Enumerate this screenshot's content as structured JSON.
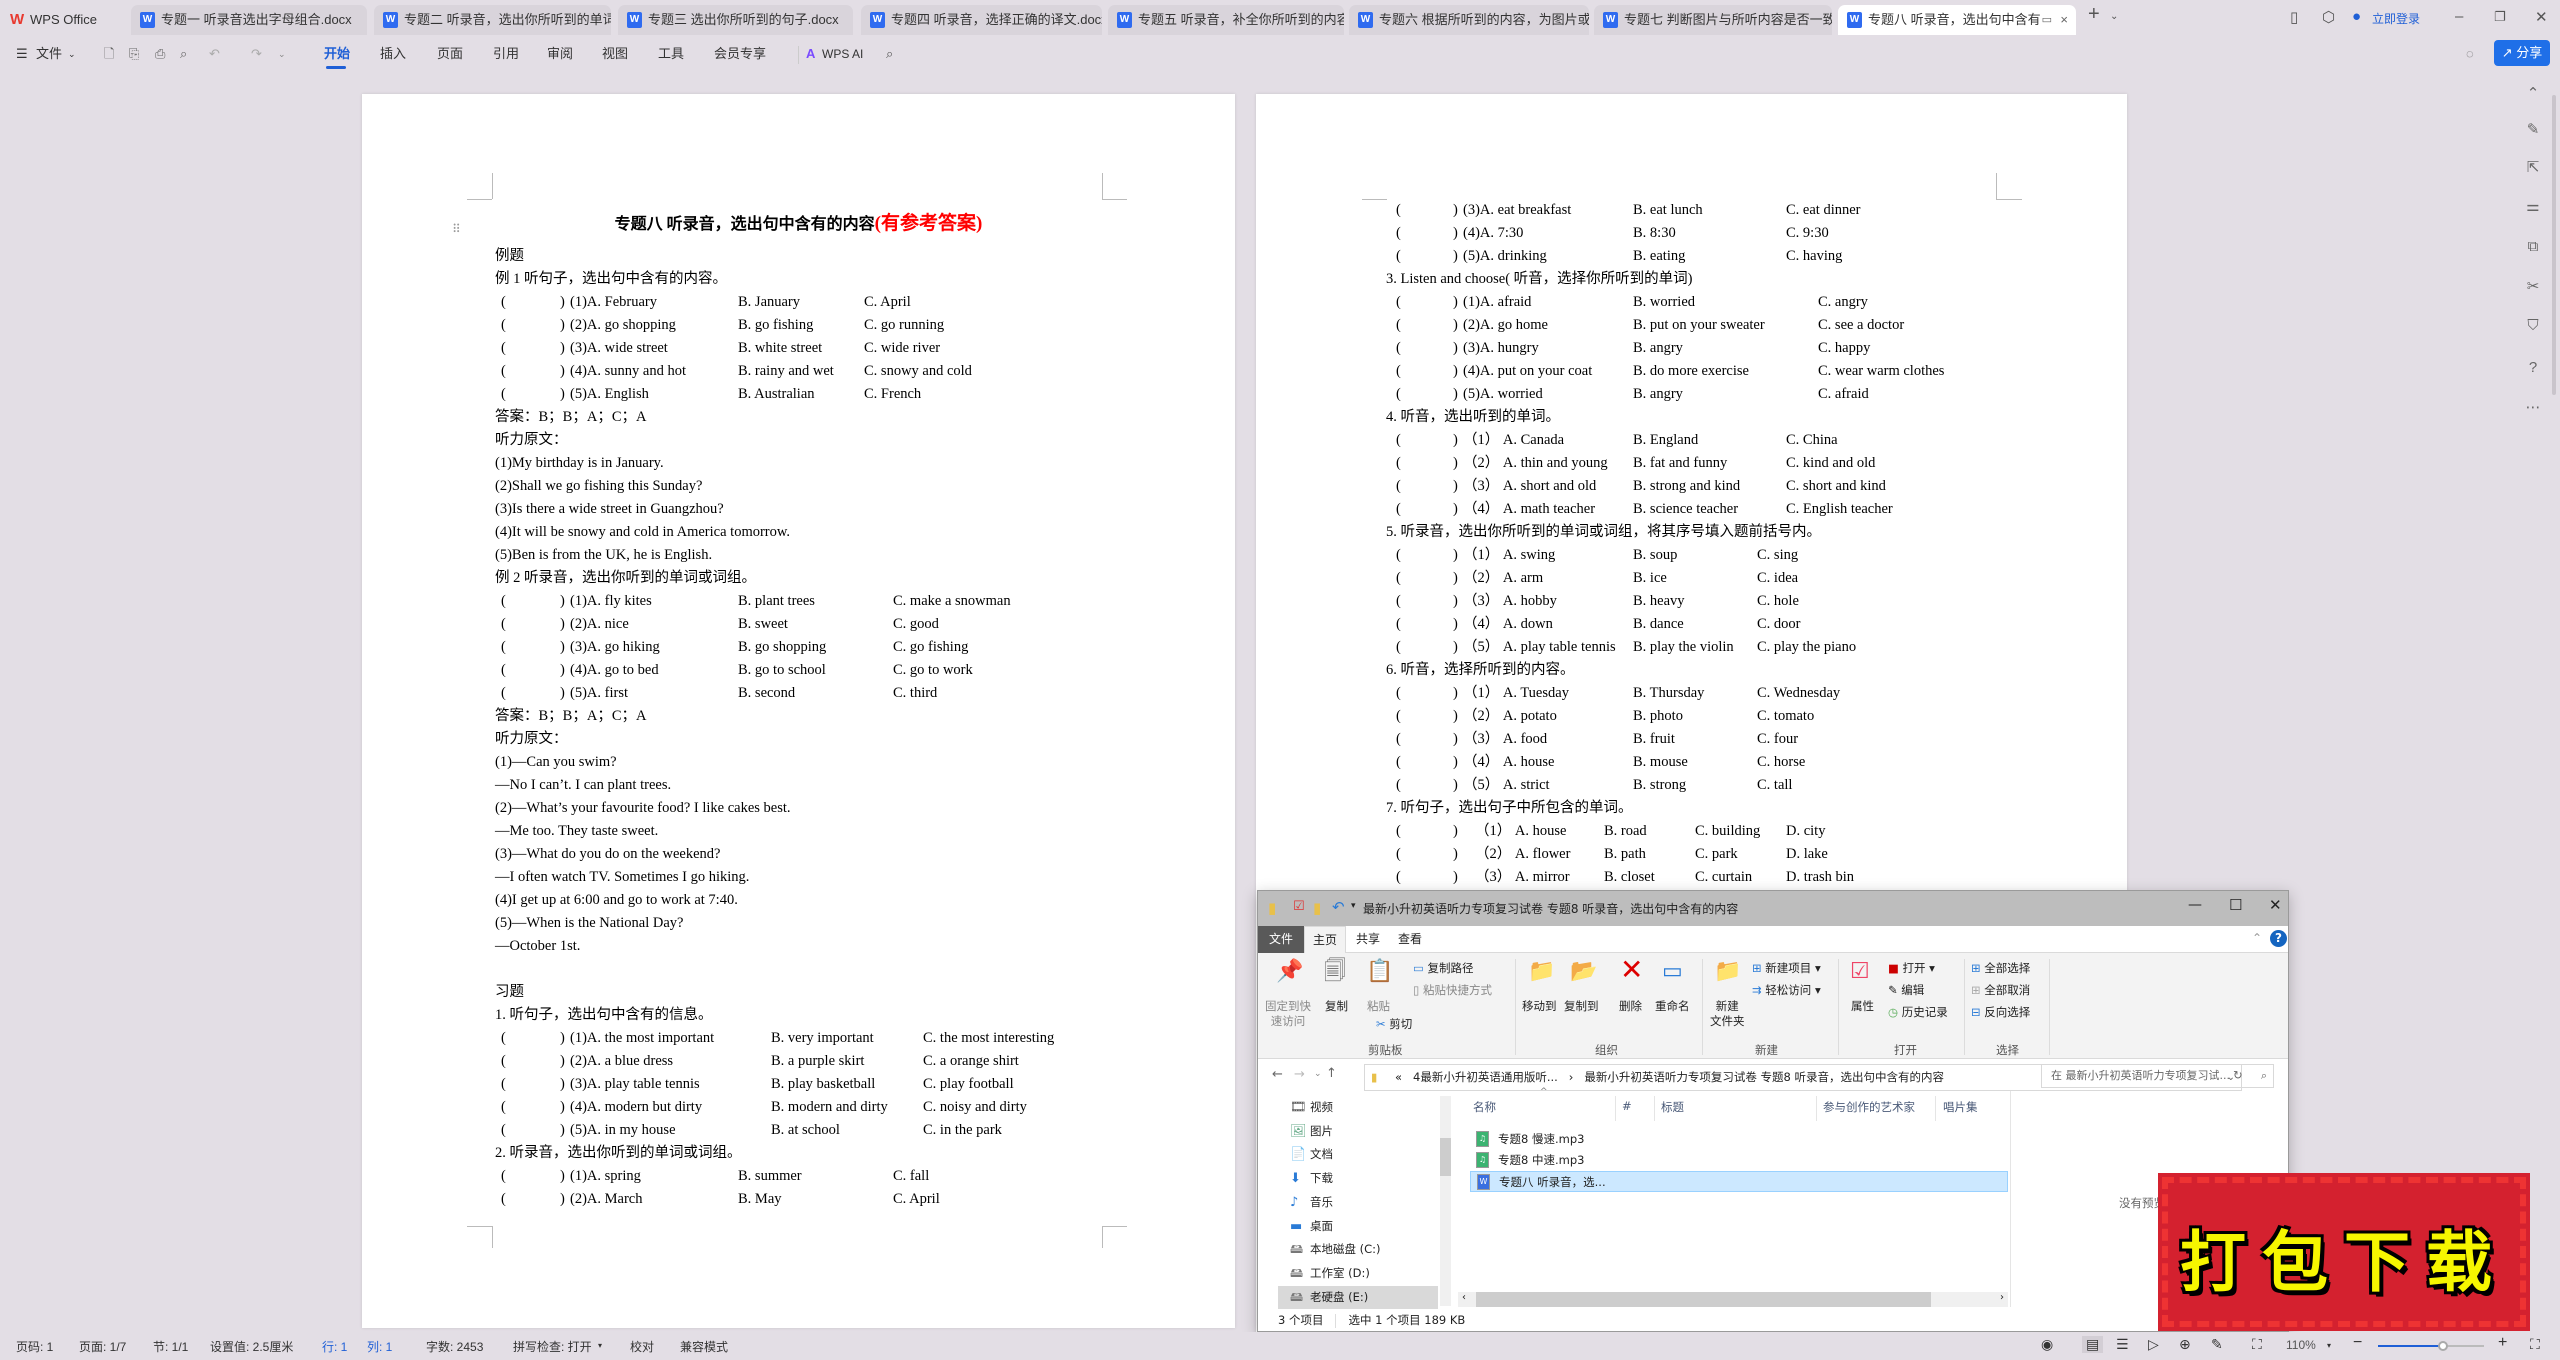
{
  "app": {
    "brand": "WPS Office",
    "tabs": [
      "专题一 听录音选出字母组合.docx",
      "专题二 听录音，选出你所听到的单词",
      "专题三 选出你所听到的句子.docx",
      "专题四 听录音，选择正确的译文.docx",
      "专题五 听录音，补全你所听到的内容",
      "专题六 根据所听到的内容，为图片或",
      "专题七 判断图片与所听内容是否一致",
      "专题八 听录音，选出句中含有"
    ],
    "active_tab": 7,
    "login": "立即登录"
  },
  "toolbar": {
    "file": "文件",
    "menus": [
      "开始",
      "插入",
      "页面",
      "引用",
      "审阅",
      "视图",
      "工具",
      "会员专享"
    ],
    "ai": "WPS AI",
    "share": "分享",
    "accent": "#1f5fd6"
  },
  "doc": {
    "title_main": "专题八  听录音，选出句中含有的内容",
    "title_note": "(有参考答案)",
    "blank": [
      "(",
      ")"
    ],
    "left_blocks": [
      {
        "heading": "例题"
      },
      {
        "heading": "例 1  听句子，选出句中含有的内容。",
        "rows": [
          [
            "(1)A. February",
            "B. January",
            "C. April"
          ],
          [
            "(2)A. go shopping",
            "B. go  fishing",
            "C. go running"
          ],
          [
            "(3)A. wide street",
            "B. white street",
            "C. wide river"
          ],
          [
            "(4)A. sunny and hot",
            "B. rainy and wet",
            "C. snowy and cold"
          ],
          [
            "(5)A. English",
            "B. Australian",
            "C. French"
          ]
        ],
        "lines": [
          "答案：B；B；A；C；A",
          "听力原文：",
          "(1)My birthday is in January.",
          "(2)Shall we go fishing this Sunday?",
          "(3)Is there a wide street in Guangzhou?",
          "(4)It will be snowy and cold in America tomorrow.",
          "(5)Ben is from the UK, he is English."
        ]
      },
      {
        "heading": "例 2 听录音，选出你听到的单词或词组。",
        "rows": [
          [
            "(1)A. fly kites",
            "B. plant trees",
            "C. make a snowman"
          ],
          [
            "(2)A. nice",
            "B. sweet",
            "C. good"
          ],
          [
            "(3)A. go hiking",
            "B. go shopping",
            "C. go fishing"
          ],
          [
            "(4)A. go to bed",
            "B. go to school",
            "C. go to work"
          ],
          [
            "(5)A. first",
            "B. second",
            "C. third"
          ]
        ],
        "lines": [
          "答案：B；B；A；C；A",
          "听力原文：",
          "(1)—Can you swim?",
          "—No I can’t. I can plant trees.",
          "(2)—What’s your favourite food? I like cakes best.",
          "—Me too. They taste sweet.",
          "(3)—What do you do on the weekend?",
          "—I often watch TV. Sometimes I go hiking.",
          "(4)I get up at 6:00 and go to work at 7:40.",
          "(5)—When is the National Day?",
          "—October 1st.",
          ""
        ]
      },
      {
        "heading": "习题"
      },
      {
        "heading": "1. 听句子，选出句中含有的信息。",
        "rows": [
          [
            "(1)A. the most important",
            "B. very important",
            "C. the most interesting"
          ],
          [
            "(2)A. a blue dress",
            "B. a purple skirt",
            "C. a orange shirt"
          ],
          [
            "(3)A. play table tennis",
            "B. play basketball",
            "C. play football"
          ],
          [
            "(4)A. modern but dirty",
            "B. modern and dirty",
            "C. noisy and dirty"
          ],
          [
            "(5)A. in my house",
            "B. at school",
            "C. in the park"
          ]
        ]
      },
      {
        "heading": "2. 听录音，选出你听到的单词或词组。",
        "rows": [
          [
            "(1)A. spring",
            "B. summer",
            "C. fall"
          ],
          [
            "(2)A. March",
            "B. May",
            "C. April"
          ]
        ]
      }
    ],
    "right_blocks": [
      {
        "rows": [
          [
            "(3)A. eat breakfast",
            "B. eat lunch",
            "C. eat dinner"
          ],
          [
            "(4)A. 7:30",
            "B. 8:30",
            "C. 9:30"
          ],
          [
            "(5)A. drinking",
            "B. eating",
            "C. having"
          ]
        ]
      },
      {
        "heading": "3. Listen and choose( 听音，选择你所听到的单词)",
        "rows": [
          [
            "(1)A. afraid",
            "B. worried",
            "C. angry"
          ],
          [
            "(2)A. go home",
            "B. put on your sweater",
            "C. see a doctor"
          ],
          [
            "(3)A. hungry",
            "B. angry",
            "C. happy"
          ],
          [
            "(4)A. put on your coat",
            "B. do more exercise",
            "C. wear warm clothes"
          ],
          [
            "(5)A. worried",
            "B. angry",
            "C. afraid"
          ]
        ]
      },
      {
        "heading": "4. 听音，选出听到的单词。",
        "rows": [
          [
            "（1） A. Canada",
            "B. England",
            "C. China"
          ],
          [
            "（2） A. thin and young",
            "B. fat and funny",
            "C. kind and old"
          ],
          [
            "（3） A. short and old",
            "B. strong and kind",
            "C. short and kind"
          ],
          [
            "（4） A. math teacher",
            "B. science teacher",
            "C. English teacher"
          ]
        ]
      },
      {
        "heading": "5. 听录音，选出你所听到的单词或词组，将其序号填入题前括号内。",
        "rows": [
          [
            "（1） A. swing",
            "B. soup",
            "C. sing"
          ],
          [
            "（2） A. arm",
            "B. ice",
            "C. idea"
          ],
          [
            "（3） A. hobby",
            "B. heavy",
            "C. hole"
          ],
          [
            "（4） A. down",
            "B. dance",
            "C. door"
          ],
          [
            "（5） A. play table tennis",
            "B. play the violin",
            "C. play the piano"
          ]
        ]
      },
      {
        "heading": "6. 听音，选择所听到的内容。",
        "rows": [
          [
            "（1） A. Tuesday",
            "B. Thursday",
            "C. Wednesday"
          ],
          [
            "（2） A. potato",
            "B. photo",
            "C. tomato"
          ],
          [
            "（3） A. food",
            "B. fruit",
            "C. four"
          ],
          [
            "（4） A. house",
            "B. mouse",
            "C. horse"
          ],
          [
            "（5） A. strict",
            "B. strong",
            "C. tall"
          ]
        ]
      },
      {
        "heading": "7. 听句子，选出句子中所包含的单词。",
        "rows": [
          [
            "（1） A. house",
            "B. road",
            "C. building",
            "D. city"
          ],
          [
            "（2） A. flower",
            "B. path",
            "C. park",
            "D. lake"
          ],
          [
            "（3） A. mirror",
            "B. closet",
            "C. curtain",
            "D. trash bin"
          ]
        ]
      }
    ]
  },
  "explorer": {
    "title": "最新小升初英语听力专项复习试卷 专题8 听录音，选出句中含有的内容",
    "tabs": [
      "文件",
      "主页",
      "共享",
      "查看"
    ],
    "ribbon": {
      "pin": [
        "固定到快",
        "速访问"
      ],
      "copy": "复制",
      "paste": "粘贴",
      "copy_path": "复制路径",
      "paste_shortcut": "粘贴快捷方式",
      "cut": "剪切",
      "clipboard": "剪贴板",
      "move_to": "移动到",
      "copy_to": "复制到",
      "delete": "删除",
      "rename": "重命名",
      "organize": "组织",
      "new_folder": [
        "新建",
        "文件夹"
      ],
      "new_item": "新建项目",
      "easy_access": "轻松访问",
      "new": "新建",
      "properties": "属性",
      "open": "打开",
      "edit": "编辑",
      "history": "历史记录",
      "open_group": "打开",
      "select_all": "全部选择",
      "select_none": "全部取消",
      "invert": "反向选择",
      "select_group": "选择"
    },
    "address": [
      "«",
      "4最新小升初英语通用版听...",
      "›",
      "最新小升初英语听力专项复习试卷 专题8 听录音，选出句中含有的内容"
    ],
    "search_placeholder": "在 最新小升初英语听力专项复习试...",
    "nav": [
      "视频",
      "图片",
      "文档",
      "下载",
      "音乐",
      "桌面",
      "本地磁盘 (C:)",
      "工作室 (D:)",
      "老硬盘 (E:)"
    ],
    "nav_selected": 8,
    "columns": [
      "名称",
      "#",
      "标题",
      "参与创作的艺术家",
      "唱片集"
    ],
    "files": [
      {
        "name": "专题8 慢速.mp3",
        "type": "mp3"
      },
      {
        "name": "专题8 中速.mp3",
        "type": "mp3"
      },
      {
        "name": "专题八 听录音，选...",
        "type": "docx",
        "selected": true
      }
    ],
    "preview_empty": "没有预览。",
    "status": [
      "3 个项目",
      "选中 1 个项目  189 KB"
    ]
  },
  "statusbar": {
    "left": [
      "页码: 1",
      "页面: 1/7",
      "节: 1/1",
      "设置值: 2.5厘米",
      "行: 1",
      "列: 1",
      "字数: 2453",
      "拼写检查: 打开",
      "校对",
      "兼容模式"
    ],
    "zoom": "110%",
    "zoom_level": 110
  },
  "stamp": {
    "text": "打包下载"
  }
}
